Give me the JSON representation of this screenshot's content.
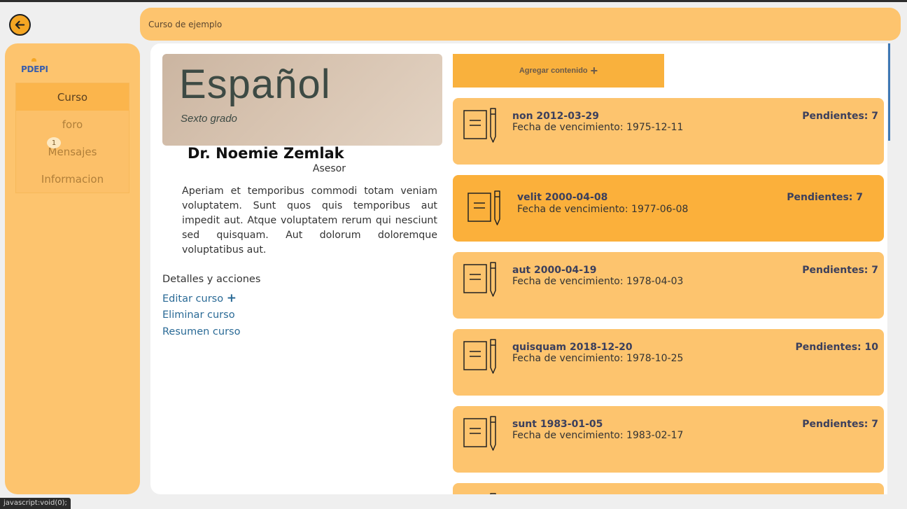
{
  "header": {
    "course_name": "Curso de ejemplo"
  },
  "sidebar": {
    "logo": "PDEPI",
    "items": [
      {
        "label": "Curso",
        "active": true
      },
      {
        "label": "foro",
        "active": false
      },
      {
        "label": "Mensajes",
        "active": false,
        "badge": "1"
      },
      {
        "label": "Informacion",
        "active": false
      }
    ]
  },
  "course": {
    "cover_title": "Español",
    "cover_subtitle": "Sexto grado",
    "teacher_name": "Dr. Noemie Zemlak",
    "teacher_role": "Asesor",
    "description": "Aperiam et temporibus commodi totam veniam voluptatem. Sunt quos quis temporibus aut impedit aut. Atque voluptatem rerum qui nesciunt sed quisquam. Aut dolorum doloremque voluptatibus aut.",
    "details_title": "Detalles y acciones",
    "actions": {
      "edit": "Editar curso",
      "edit_plus": "+",
      "delete": "Eliminar curso",
      "summary": "Resumen curso"
    }
  },
  "content": {
    "add_label": "Agregar contenido",
    "add_plus": "+",
    "items": [
      {
        "name": "non 2012-03-29",
        "due": "Fecha de vencimiento: 1975-12-11",
        "pending": "Pendientes: 7",
        "icon": "document-pencil-icon"
      },
      {
        "name": "velit 2000-04-08",
        "due": "Fecha de vencimiento: 1977-06-08",
        "pending": "Pendientes: 7",
        "icon": "document-pencil-icon"
      },
      {
        "name": "aut 2000-04-19",
        "due": "Fecha de vencimiento: 1978-04-03",
        "pending": "Pendientes: 7",
        "icon": "document-pencil-icon"
      },
      {
        "name": "quisquam 2018-12-20",
        "due": "Fecha de vencimiento: 1978-10-25",
        "pending": "Pendientes: 10",
        "icon": "document-pencil-icon"
      },
      {
        "name": "sunt 1983-01-05",
        "due": "Fecha de vencimiento: 1983-02-17",
        "pending": "Pendientes: 7",
        "icon": "document-pencil-icon"
      }
    ]
  },
  "status_bar": {
    "text": "javascript:void(0);"
  },
  "colors": {
    "accent": "#f5a623",
    "panel": "#fdc46e",
    "card_highlight": "#fbb03b",
    "link": "#2a6a96"
  }
}
